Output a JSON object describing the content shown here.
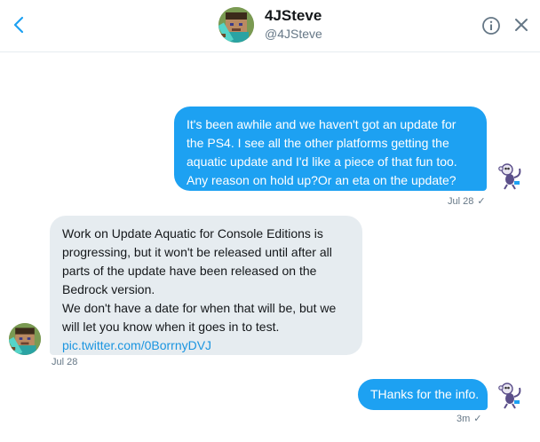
{
  "header": {
    "name": "4JSteve",
    "handle": "@4JSteve",
    "back_icon": "chevron-left-icon",
    "info_icon": "info-icon",
    "close_icon": "close-icon"
  },
  "messages": [
    {
      "direction": "outgoing",
      "lines": [
        "It's been awhile and we haven't got an update for",
        "the PS4. I see all the other platforms getting the",
        "aquatic update and I'd like a piece of that fun too.",
        "Any reason on hold up?Or an eta on the update?"
      ],
      "time": "Jul 28",
      "status": "✓"
    },
    {
      "direction": "incoming",
      "lines": [
        "Work on Update Aquatic for Console Editions is",
        "progressing, but it won't be released until after all",
        "parts of the update have been released on the",
        "Bedrock version.",
        "We don't have a date for when that will be, but we",
        "will let you know when it goes in to test."
      ],
      "link": "pic.twitter.com/0BorrnyDVJ",
      "time": "Jul 28"
    },
    {
      "direction": "outgoing",
      "lines": [
        "THanks for the info."
      ],
      "time": "3m",
      "status": "✓"
    }
  ],
  "colors": {
    "accent": "#1da1f2",
    "incoming_bubble": "#e6ecf0",
    "link": "#1b95e0",
    "muted": "#657786"
  }
}
